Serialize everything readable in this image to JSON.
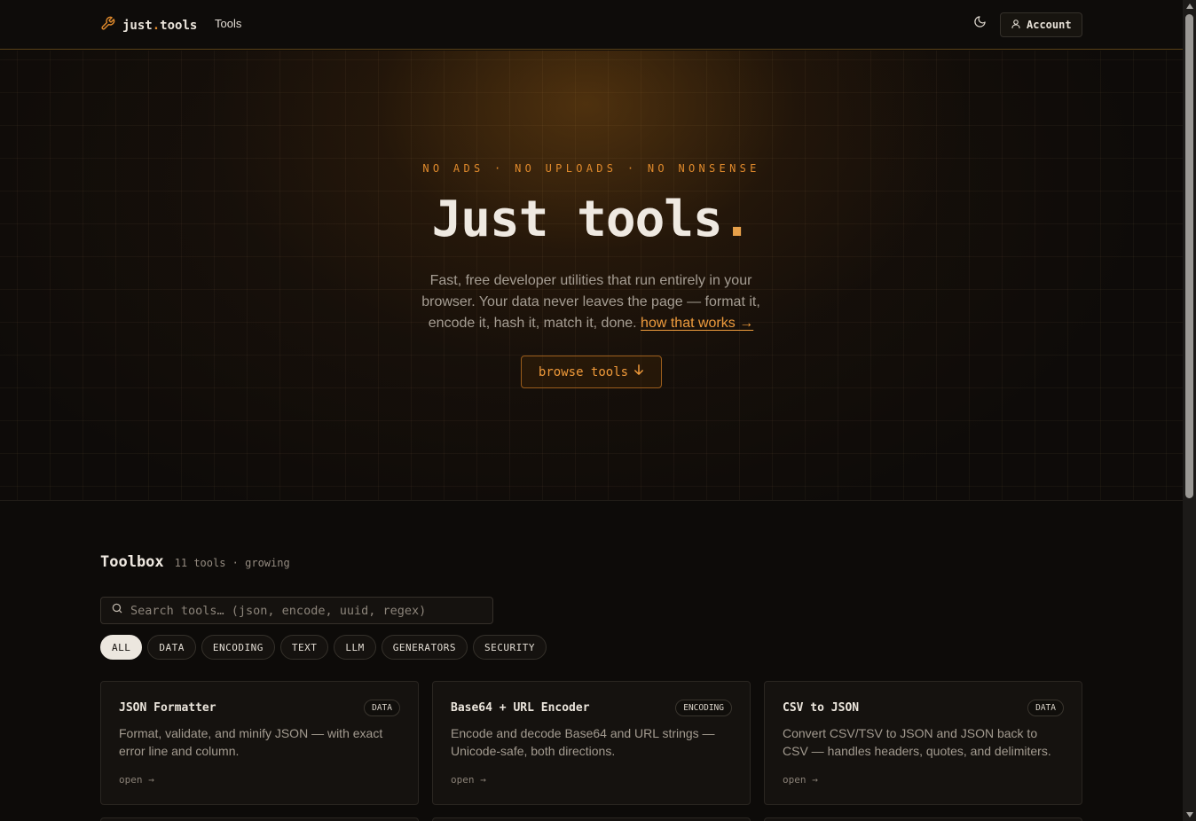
{
  "header": {
    "logo_prefix": "just",
    "logo_dot": ".",
    "logo_suffix": "tools",
    "logo_icon": "wrench-icon",
    "nav_tools": "Tools",
    "theme_icon": "moon-icon",
    "account_label": "Account",
    "account_icon": "user-icon"
  },
  "hero": {
    "eyebrow": "NO ADS · NO UPLOADS · NO NONSENSE",
    "title": "Just tools",
    "title_dot": ".",
    "subtitle": "Fast, free developer utilities that run entirely in your browser. Your data never leaves the page — format it, encode it, hash it, match it, done.",
    "link": "how that works →",
    "cta": "browse tools",
    "cta_icon": "arrow-down-icon"
  },
  "toolbox": {
    "title": "Toolbox",
    "meta": "11 tools · growing",
    "search_placeholder": "Search tools… (json, encode, uuid, regex)",
    "filters": [
      "ALL",
      "DATA",
      "ENCODING",
      "TEXT",
      "LLM",
      "GENERATORS",
      "SECURITY"
    ],
    "active_filter": "ALL",
    "cards": [
      {
        "title": "JSON Formatter",
        "tag": "DATA",
        "desc": "Format, validate, and minify JSON — with exact error line and column.",
        "open": "open →"
      },
      {
        "title": "Base64 + URL Encoder",
        "tag": "ENCODING",
        "desc": "Encode and decode Base64 and URL strings — Unicode-safe, both directions.",
        "open": "open →"
      },
      {
        "title": "CSV to JSON",
        "tag": "DATA",
        "desc": "Convert CSV/TSV to JSON and JSON back to CSV — handles headers, quotes, and delimiters.",
        "open": "open →"
      }
    ]
  },
  "colors": {
    "accent": "#e08a2c",
    "background": "#0d0b09",
    "card": "#15120f"
  }
}
